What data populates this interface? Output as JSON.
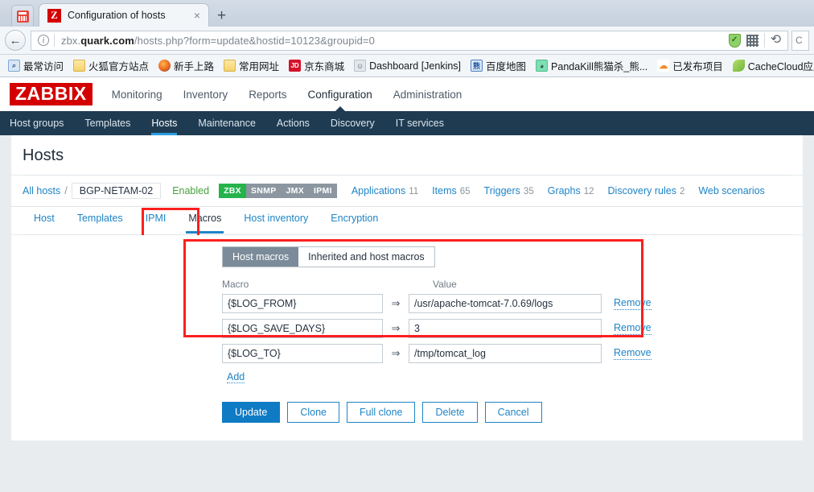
{
  "browser": {
    "tab": {
      "title": "Configuration of hosts",
      "favicon_letter": "Z",
      "close_label": "×",
      "newtab_label": "+"
    },
    "nav": {
      "back_label": "←",
      "reload_label": "⟳",
      "info_label": "i"
    },
    "url": {
      "prefix": "zbx.",
      "domain": "quark.com",
      "path": "/hosts.php?form=update&hostid=10123&groupid=0"
    },
    "bookmarks": [
      {
        "label": "最常访问",
        "icon": "star-page-icon",
        "icon_text": "⌕"
      },
      {
        "label": "火狐官方站点",
        "icon": "folder-icon",
        "icon_text": ""
      },
      {
        "label": "新手上路",
        "icon": "firefox-icon",
        "icon_text": ""
      },
      {
        "label": "常用网址",
        "icon": "folder-icon",
        "icon_text": ""
      },
      {
        "label": "京东商城",
        "icon": "jd-icon",
        "icon_text": "JD"
      },
      {
        "label": "Dashboard [Jenkins]",
        "icon": "jenkins-icon",
        "icon_text": "☺"
      },
      {
        "label": "百度地图",
        "icon": "baidu-icon",
        "icon_text": "熊"
      },
      {
        "label": "PandaKill熊猫杀_熊...",
        "icon": "panda-icon",
        "icon_text": "◕"
      },
      {
        "label": "已发布项目",
        "icon": "cloud-icon",
        "icon_text": "☁"
      },
      {
        "label": "CacheCloud应用列",
        "icon": "leaf-icon",
        "icon_text": ""
      }
    ]
  },
  "app": {
    "logo": "ZABBIX",
    "main_menu": [
      {
        "label": "Monitoring",
        "selected": false
      },
      {
        "label": "Inventory",
        "selected": false
      },
      {
        "label": "Reports",
        "selected": false
      },
      {
        "label": "Configuration",
        "selected": true
      },
      {
        "label": "Administration",
        "selected": false
      }
    ],
    "sub_menu": [
      {
        "label": "Host groups",
        "selected": false
      },
      {
        "label": "Templates",
        "selected": false
      },
      {
        "label": "Hosts",
        "selected": true
      },
      {
        "label": "Maintenance",
        "selected": false
      },
      {
        "label": "Actions",
        "selected": false
      },
      {
        "label": "Discovery",
        "selected": false
      },
      {
        "label": "IT services",
        "selected": false
      }
    ],
    "page_title": "Hosts"
  },
  "hostbar": {
    "all_hosts": "All hosts",
    "separator": "/",
    "host_name": "BGP-NETAM-02",
    "status": "Enabled",
    "interface_badges": [
      {
        "label": "ZBX",
        "active": true
      },
      {
        "label": "SNMP",
        "active": false
      },
      {
        "label": "JMX",
        "active": false
      },
      {
        "label": "IPMI",
        "active": false
      }
    ],
    "links": [
      {
        "label": "Applications",
        "count": "11"
      },
      {
        "label": "Items",
        "count": "65"
      },
      {
        "label": "Triggers",
        "count": "35"
      },
      {
        "label": "Graphs",
        "count": "12"
      },
      {
        "label": "Discovery rules",
        "count": "2"
      },
      {
        "label": "Web scenarios",
        "count": ""
      }
    ]
  },
  "form_tabs": [
    {
      "label": "Host",
      "selected": false
    },
    {
      "label": "Templates",
      "selected": false
    },
    {
      "label": "IPMI",
      "selected": false
    },
    {
      "label": "Macros",
      "selected": true
    },
    {
      "label": "Host inventory",
      "selected": false
    },
    {
      "label": "Encryption",
      "selected": false
    }
  ],
  "macros_panel": {
    "toggle": [
      {
        "label": "Host macros",
        "selected": true
      },
      {
        "label": "Inherited and host macros",
        "selected": false
      }
    ],
    "columns": {
      "macro": "Macro",
      "value": "Value"
    },
    "arrow": "⇒",
    "rows": [
      {
        "macro": "{$LOG_FROM}",
        "value": "/usr/apache-tomcat-7.0.69/logs",
        "remove": "Remove"
      },
      {
        "macro": "{$LOG_SAVE_DAYS}",
        "value": "3",
        "remove": "Remove"
      },
      {
        "macro": "{$LOG_TO}",
        "value": "/tmp/tomcat_log",
        "remove": "Remove"
      }
    ],
    "add_label": "Add"
  },
  "buttons": [
    {
      "label": "Update",
      "primary": true
    },
    {
      "label": "Clone",
      "primary": false
    },
    {
      "label": "Full clone",
      "primary": false
    },
    {
      "label": "Delete",
      "primary": false
    },
    {
      "label": "Cancel",
      "primary": false
    }
  ],
  "colors": {
    "brand_red": "#d40000",
    "accent_blue": "#1f84c6",
    "submenu_bg": "#1f3b52",
    "enabled_green": "#45a33e",
    "badge_active": "#25b44c",
    "annotation_red": "#fb1f1f"
  }
}
